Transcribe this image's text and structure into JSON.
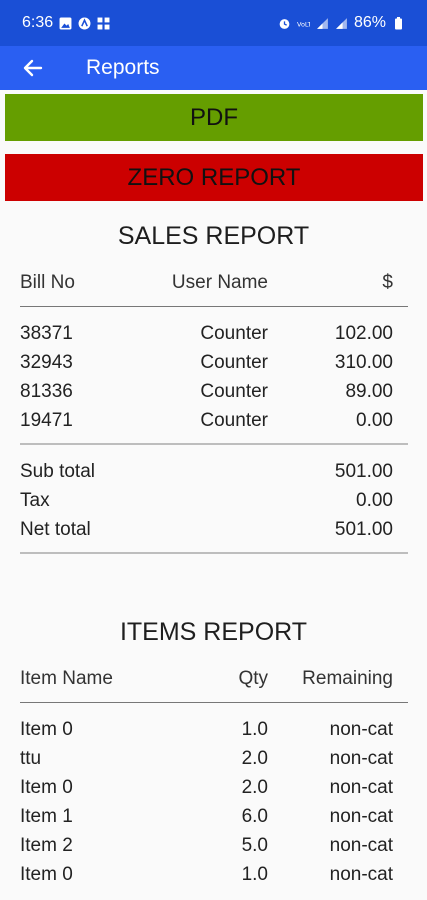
{
  "status": {
    "time": "6:36",
    "battery": "86%"
  },
  "appbar": {
    "title": "Reports"
  },
  "buttons": {
    "pdf": "PDF",
    "zero": "ZERO REPORT"
  },
  "sales": {
    "title": "SALES REPORT",
    "headers": {
      "bill": "Bill No",
      "user": "User Name",
      "amount": "$"
    },
    "rows": [
      {
        "bill": "38371",
        "user": "Counter",
        "amount": "102.00"
      },
      {
        "bill": "32943",
        "user": "Counter",
        "amount": "310.00"
      },
      {
        "bill": "81336",
        "user": "Counter",
        "amount": "89.00"
      },
      {
        "bill": "19471",
        "user": "Counter",
        "amount": "0.00"
      }
    ],
    "totals": [
      {
        "label": "Sub total",
        "value": "501.00"
      },
      {
        "label": "Tax",
        "value": "0.00"
      },
      {
        "label": "Net total",
        "value": "501.00"
      }
    ]
  },
  "items": {
    "title": "ITEMS REPORT",
    "headers": {
      "name": "Item Name",
      "qty": "Qty",
      "remaining": "Remaining"
    },
    "rows": [
      {
        "name": "Item 0",
        "qty": "1.0",
        "remaining": "non-cat"
      },
      {
        "name": "ttu",
        "qty": "2.0",
        "remaining": "non-cat"
      },
      {
        "name": "Item 0",
        "qty": "2.0",
        "remaining": "non-cat"
      },
      {
        "name": "Item 1",
        "qty": "6.0",
        "remaining": "non-cat"
      },
      {
        "name": "Item 2",
        "qty": "5.0",
        "remaining": "non-cat"
      },
      {
        "name": "Item 0",
        "qty": "1.0",
        "remaining": "non-cat"
      }
    ]
  }
}
